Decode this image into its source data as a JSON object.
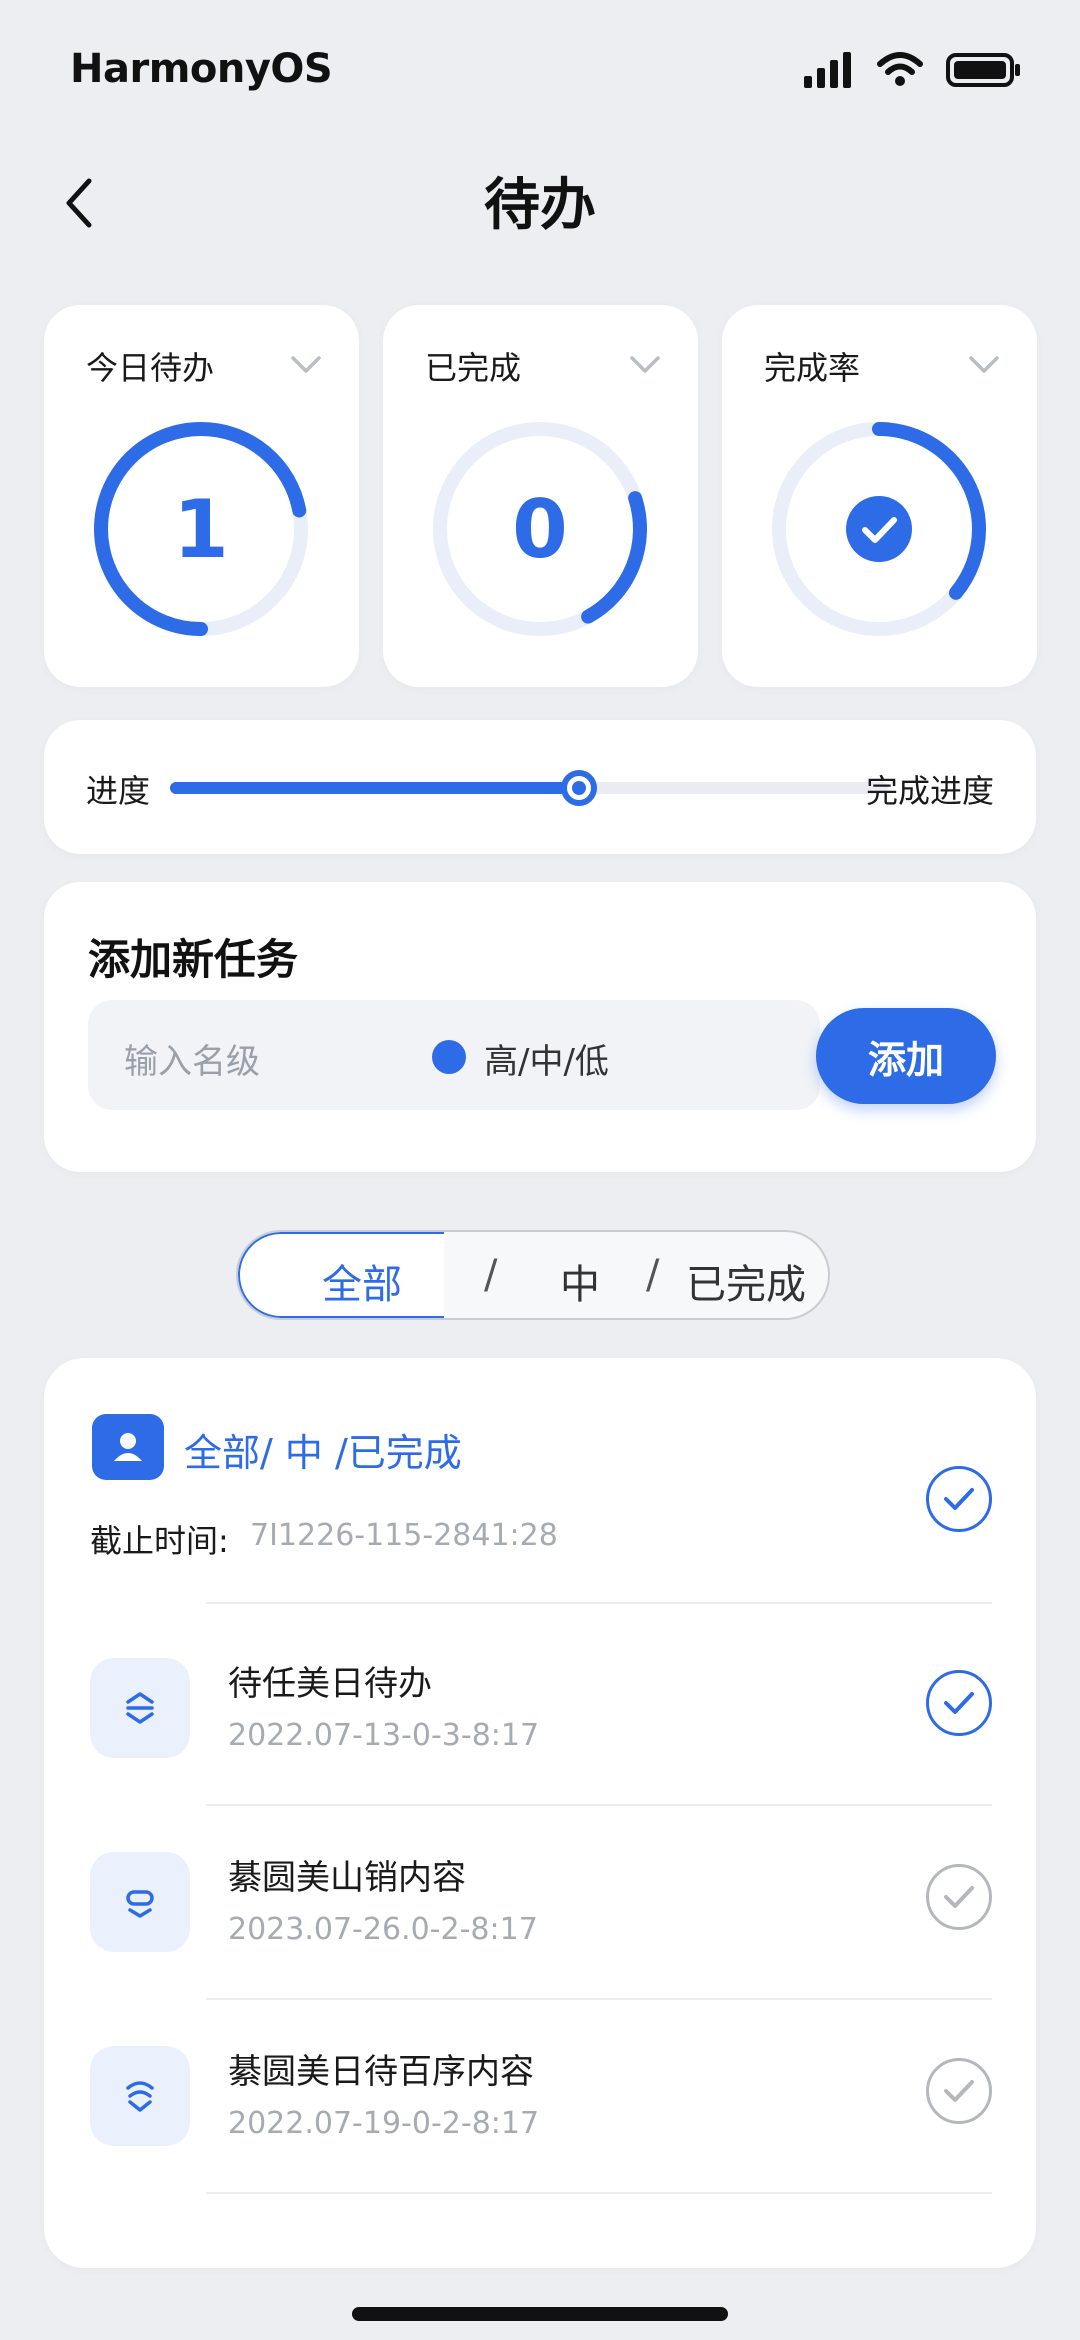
{
  "status_bar": {
    "brand": "HarmonyOS",
    "icons": [
      "signal-icon",
      "wifi-icon",
      "battery-icon"
    ]
  },
  "nav": {
    "title": "待办",
    "back_icon": "chevron-left-icon"
  },
  "stats": [
    {
      "title": "今日待办",
      "value": "1",
      "progress": 0.72,
      "icon": "chevron-down-icon"
    },
    {
      "title": "已完成",
      "value": "0",
      "progress": 0.22,
      "icon": "chevron-down-icon"
    },
    {
      "title": "完成率",
      "value": "",
      "progress": 0.36,
      "icon": "check-circle-icon"
    }
  ],
  "progress": {
    "left_label": "进度",
    "right_label": "完成进度",
    "value": 0.57
  },
  "add_task": {
    "title": "添加新任务",
    "placeholder": "输入名级",
    "priority": "高/中/低",
    "button": "添加"
  },
  "filter": {
    "items": [
      "全部",
      "中",
      "已完成"
    ],
    "separators": [
      "/",
      "/"
    ],
    "active": "全部"
  },
  "list": {
    "header": {
      "title": "全部/  中 /已完成",
      "deadline_label": "截止时间:",
      "deadline_value": "7I1226-115-2841:28",
      "checked": true
    },
    "items": [
      {
        "title": "待任美日待办",
        "date": "2022.07-13-0-3-8:17",
        "icon": "priority-high-icon",
        "checked": true
      },
      {
        "title": "綦圆美山销内容",
        "date": "2023.07-26.0-2-8:17",
        "icon": "priority-medium-icon",
        "checked": false
      },
      {
        "title": "綦圆美日待百序内容",
        "date": "2022.07-19-0-2-8:17",
        "icon": "priority-low-icon",
        "checked": false
      }
    ]
  },
  "colors": {
    "accent": "#2e6be6",
    "background": "#eceef2",
    "card": "#ffffff",
    "muted": "#a6abb3"
  }
}
